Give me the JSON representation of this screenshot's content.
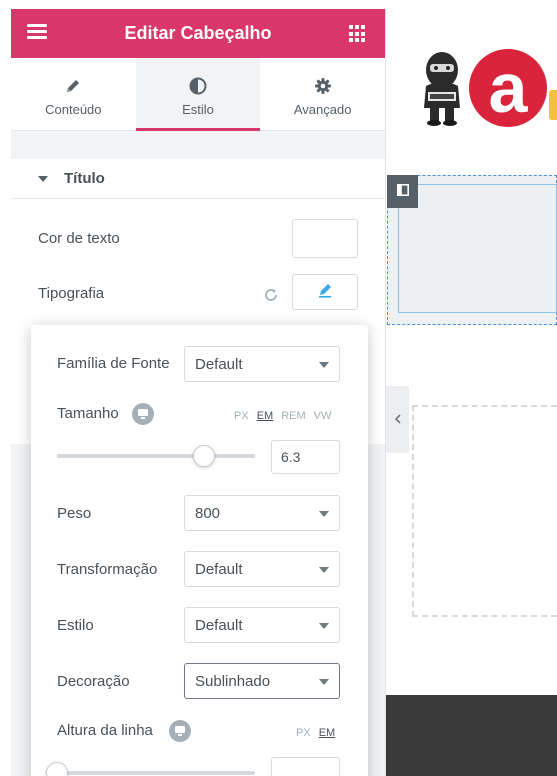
{
  "panel": {
    "title": "Editar Cabeçalho",
    "menu_icon": "hamburger-icon",
    "apps_icon": "grid-icon",
    "accent": "#d9376a",
    "tabs": [
      {
        "label": "Conteúdo",
        "icon": "pencil-icon",
        "active": false
      },
      {
        "label": "Estilo",
        "icon": "half-circle-icon",
        "active": true
      },
      {
        "label": "Avançado",
        "icon": "gear-icon",
        "active": false
      }
    ],
    "section": {
      "label": "Título",
      "text_color_label": "Cor de texto",
      "typography_label": "Tipografia"
    }
  },
  "typography": {
    "font_family": {
      "label": "Família de Fonte",
      "value": "Default"
    },
    "size": {
      "label": "Tamanho",
      "units": [
        "PX",
        "EM",
        "REM",
        "VW"
      ],
      "unit": "EM",
      "value": "6.3",
      "slider_fraction": 0.74
    },
    "weight": {
      "label": "Peso",
      "value": "800"
    },
    "transform": {
      "label": "Transformação",
      "value": "Default"
    },
    "style": {
      "label": "Estilo",
      "value": "Default"
    },
    "decoration": {
      "label": "Decoração",
      "value": "Sublinhado"
    },
    "line_height": {
      "label": "Altura da linha",
      "units": [
        "PX",
        "EM"
      ],
      "unit": "EM",
      "slider_fraction": 0.0
    }
  },
  "canvas": {
    "brand_letter": "a",
    "brand_color": "#d9243c"
  }
}
